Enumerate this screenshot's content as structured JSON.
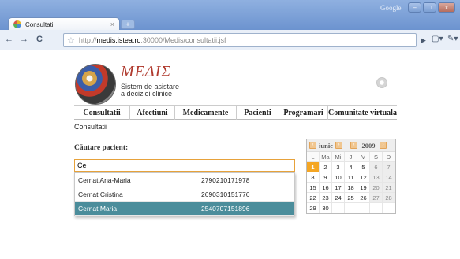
{
  "browser": {
    "tab_title": "Consultatii",
    "tab_close": "×",
    "new_tab": "+",
    "google_label": "Google",
    "window_buttons": {
      "minimize": "–",
      "maximize": "□",
      "close": "x"
    },
    "nav": {
      "back": "←",
      "forward": "→",
      "reload": "C"
    },
    "url_prefix": "http://",
    "url_host": "medis.istea.ro",
    "url_path": ":30000/Medis/consultatii.jsf",
    "icons": [
      "favicon-icon",
      "star-icon",
      "go-icon",
      "page-menu-icon",
      "wrench-icon"
    ]
  },
  "app": {
    "logo_title": "ΜΕΔΙΣ",
    "logo_sub_line1": "Sistem de asistare",
    "logo_sub_line2": "a deciziei clinice"
  },
  "menu": [
    {
      "label": "Consultatii"
    },
    {
      "label": "Afectiuni"
    },
    {
      "label": "Medicamente"
    },
    {
      "label": "Pacienti"
    },
    {
      "label": "Programari"
    },
    {
      "label": "Comunitate virtuala"
    }
  ],
  "breadcrumb": "Consultatii",
  "search": {
    "label": "Căutare pacient:",
    "value": "Ce",
    "suggestions": [
      {
        "name": "Cernat Ana-Maria",
        "code": "2790210171978",
        "selected": false
      },
      {
        "name": "Cernat Cristina",
        "code": "2690310151776",
        "selected": false
      },
      {
        "name": "Cernat Maria",
        "code": "2540707151896",
        "selected": true
      }
    ]
  },
  "calendar": {
    "month": "iunie",
    "year": "2009",
    "prev": "‹",
    "next": "›",
    "weekdays": [
      "L",
      "Ma",
      "Mi",
      "J",
      "V",
      "S",
      "D"
    ],
    "weeks": [
      [
        "1",
        "2",
        "3",
        "4",
        "5",
        "6",
        "7"
      ],
      [
        "8",
        "9",
        "10",
        "11",
        "12",
        "13",
        "14"
      ],
      [
        "15",
        "16",
        "17",
        "18",
        "19",
        "20",
        "21"
      ],
      [
        "22",
        "23",
        "24",
        "25",
        "26",
        "27",
        "28"
      ],
      [
        "29",
        "30",
        "",
        "",
        "",
        "",
        ""
      ]
    ],
    "today": "1",
    "colors": {
      "today": "#f5a623",
      "selected_row": "#4b8d9b",
      "input_border": "#e7a23b"
    }
  }
}
